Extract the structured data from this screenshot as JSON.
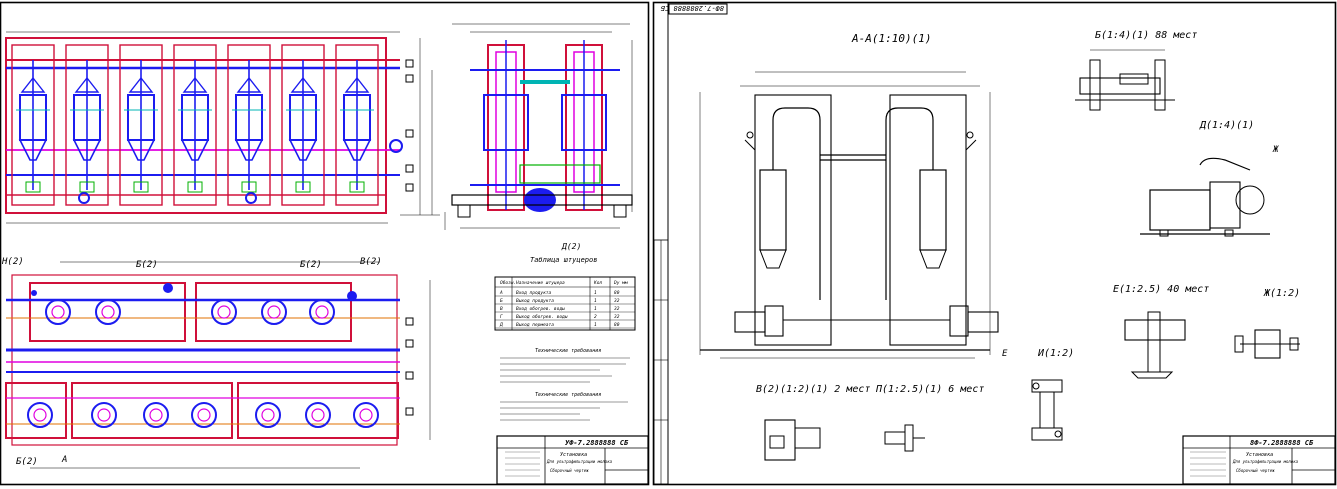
{
  "colors": {
    "frame": "#000000",
    "pipe_red": "#d0103a",
    "pipe_blue": "#1c1cf0",
    "pipe_magenta": "#e000e0",
    "pipe_cyan": "#00b4b4",
    "pipe_green": "#00b000",
    "pipe_orange": "#e07000"
  },
  "sheet1": {
    "stamp_small": "",
    "plan_labels": {
      "b2_left": "Б(2)",
      "b2_right": "Б(2)",
      "v2": "В(2)",
      "n2": "Н(2)",
      "b2_bottom": "Б(2)",
      "a": "А"
    },
    "section_label": "Д(2)",
    "nozzle_table": {
      "title": "Таблица штуцеров",
      "headers": [
        "Обозн.",
        "Назначение штуцера",
        "Кол",
        "Dy мм"
      ],
      "rows": [
        [
          "А",
          "Вход продукта",
          "1",
          "80"
        ],
        [
          "Б",
          "Выход продукта",
          "1",
          "32"
        ],
        [
          "В",
          "Вход обогрев. воды",
          "1",
          "32"
        ],
        [
          "Г",
          "Выход обогрев. воды",
          "2",
          "32"
        ],
        [
          "Д",
          "Выход пермеата",
          "1",
          "80"
        ]
      ]
    },
    "notes_title": "Технические требования",
    "notes2_title": "Технические требования",
    "title_block": {
      "code": "УФ-7.2888888 СБ",
      "name": "Установка",
      "subtitle": "Для ультрафильтрации молока",
      "sheet_type": "Сборочный чертеж"
    }
  },
  "sheet2": {
    "stamp": "8Ф-7.2888888 СБ",
    "views": {
      "a_a": "А-А(1:10)(1)",
      "b": "Б(1:4)(1) 88 мест",
      "d": "Д(1:4)(1)",
      "zh_mark": "Ж",
      "e": "Е(1:2.5) 40 мест",
      "zh": "Ж(1:2)",
      "i": "И(1:2)",
      "v": "В(2)(1:2)(1) 2 мест",
      "p": "П(1:2.5)(1) 6 мест",
      "e_mark": "Е"
    },
    "title_block": {
      "code": "8Ф-7.2888888 СБ",
      "name": "Установка",
      "subtitle": "Для ультрафильтрации молока",
      "sheet_type": "Сборочный чертеж"
    }
  }
}
